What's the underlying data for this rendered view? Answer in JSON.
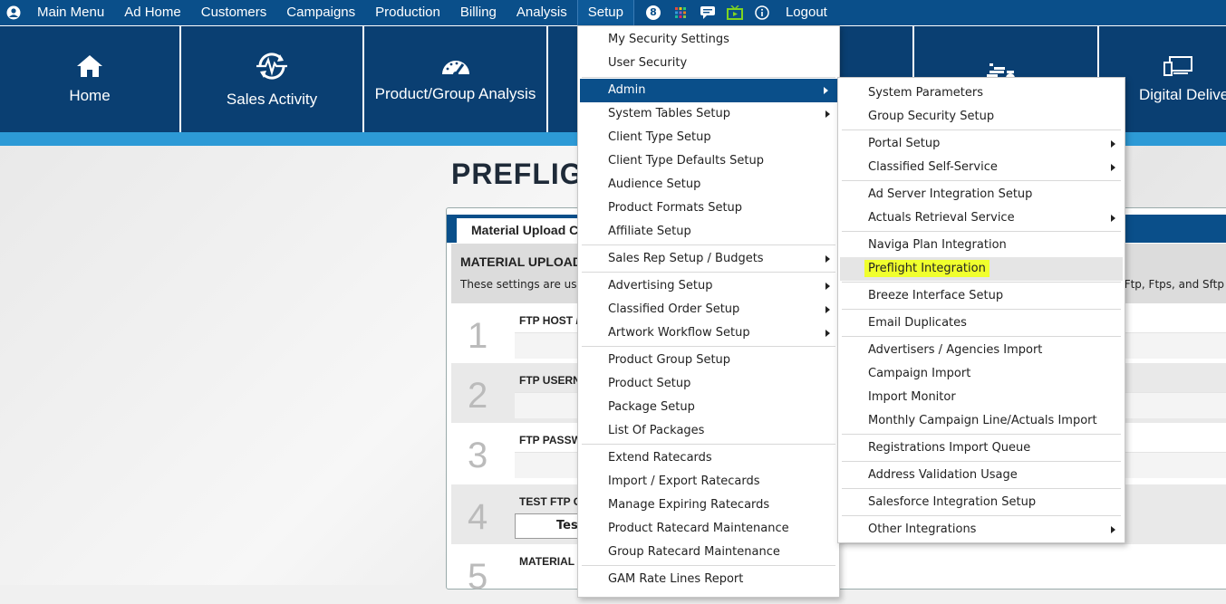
{
  "topnav": {
    "items": [
      "Main Menu",
      "Ad Home",
      "Customers",
      "Campaigns",
      "Production",
      "Billing",
      "Analysis",
      "Setup"
    ],
    "badge": "8",
    "logout": "Logout",
    "icons": [
      "user-icon",
      "badge-8-icon",
      "apps-grid-icon",
      "chat-icon",
      "tv-icon",
      "info-icon"
    ]
  },
  "tiles": [
    {
      "label": "Home",
      "icon": "home-icon"
    },
    {
      "label": "Sales Activity",
      "icon": "pulse-sync-icon"
    },
    {
      "label": "Product/Group Analysis",
      "icon": "gauge-icon"
    },
    {
      "label": "Digital Delive",
      "icon": "devices-icon"
    }
  ],
  "page": {
    "title": "PREFLIG",
    "tab": "Material Upload Co",
    "section_title": "MATERIAL UPLOAD",
    "section_desc": "These settings are used",
    "section_desc_right": ", Ftp, Ftps, and Sftp",
    "rows": [
      {
        "num": "1",
        "label": "FTP HOST /"
      },
      {
        "num": "2",
        "label": "FTP USERNA"
      },
      {
        "num": "3",
        "label": "FTP PASSW"
      },
      {
        "num": "4",
        "label": "TEST FTP CO",
        "button": "Test"
      },
      {
        "num": "5",
        "label": "MATERIAL S"
      }
    ]
  },
  "setup_menu": {
    "items": [
      "My Security Settings",
      "User Security",
      "Admin",
      "System Tables Setup",
      "Client Type Setup",
      "Client Type Defaults Setup",
      "Audience Setup",
      "Product Formats Setup",
      "Affiliate Setup",
      "Sales Rep Setup / Budgets",
      "Advertising Setup",
      "Classified Order Setup",
      "Artwork Workflow Setup",
      "Product Group Setup",
      "Product Setup",
      "Package Setup",
      "List Of Packages",
      "Extend Ratecards",
      "Import / Export Ratecards",
      "Manage Expiring Ratecards",
      "Product Ratecard Maintenance",
      "Group Ratecard Maintenance",
      "GAM Rate Lines Report"
    ]
  },
  "admin_menu": {
    "items": [
      "System Parameters",
      "Group Security Setup",
      "Portal Setup",
      "Classified Self-Service",
      "Ad Server Integration Setup",
      "Actuals Retrieval Service",
      "Naviga Plan Integration",
      "Preflight Integration",
      "Breeze Interface Setup",
      "Email Duplicates",
      "Advertisers / Agencies Import",
      "Campaign Import",
      "Import Monitor",
      "Monthly Campaign Line/Actuals Import",
      "Registrations Import Queue",
      "Address Validation Usage",
      "Salesforce Integration Setup",
      "Other Integrations"
    ]
  },
  "colors": {
    "nav": "#0a4f8a",
    "tile": "#0a3f72",
    "band": "#2d9ad6",
    "highlight": "#f0ff2d"
  }
}
